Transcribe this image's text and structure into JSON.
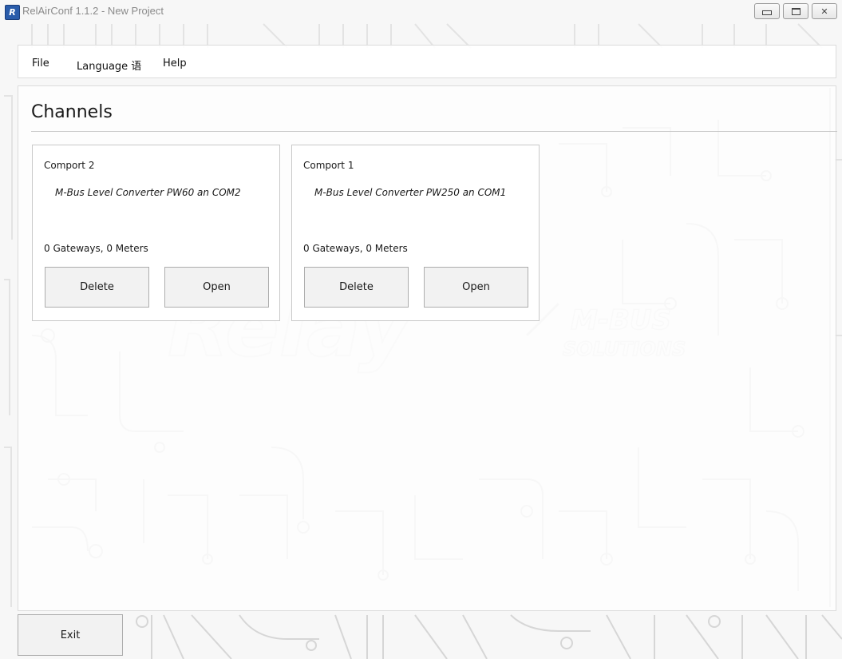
{
  "window": {
    "title": "RelAirConf 1.1.2 - New Project",
    "app_icon_letter": "R",
    "controls": {
      "minimize_icon": "minimize-icon",
      "maximize_icon": "maximize-icon",
      "close_icon": "close-icon",
      "close_glyph": "✕"
    }
  },
  "menu": {
    "file_label": "File",
    "language_label": "Language 语",
    "help_label": "Help"
  },
  "main": {
    "section_title": "Channels",
    "channels": [
      {
        "title": "Comport 2",
        "description": "M-Bus Level Converter PW60 an COM2",
        "stats": "0 Gateways, 0 Meters",
        "delete_label": "Delete",
        "open_label": "Open"
      },
      {
        "title": "Comport 1",
        "description": "M-Bus Level Converter PW250 an COM1",
        "stats": "0 Gateways, 0 Meters",
        "delete_label": "Delete",
        "open_label": "Open"
      }
    ]
  },
  "footer": {
    "exit_label": "Exit"
  },
  "colors": {
    "window_bg": "#f7f7f7",
    "panel_border": "#dcdcdc",
    "button_bg": "#f2f2f2",
    "circuit_line": "#e4e4e4",
    "app_icon": "#2a5caa"
  }
}
